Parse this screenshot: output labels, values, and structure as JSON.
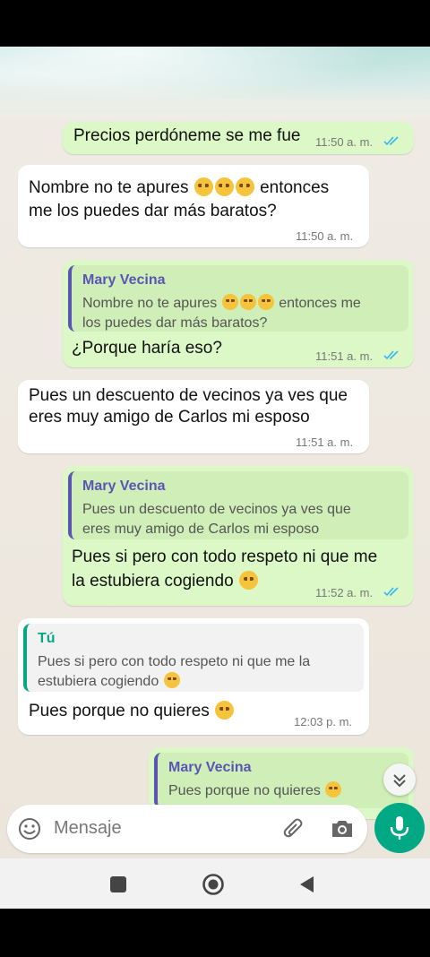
{
  "messages": [
    {
      "dir": "out",
      "text": "Precios perdóneme se me fue",
      "time": "11:50 a. m."
    },
    {
      "dir": "in",
      "line1_a": "Nombre no te apures",
      "line1_b": "entonces",
      "line2": "me los puedes dar más baratos?",
      "time": "11:50 a. m."
    },
    {
      "dir": "out",
      "quote_name": "Mary Vecina",
      "quote_l1_a": "Nombre no te apures",
      "quote_l1_b": "entonces me",
      "quote_l2": "los puedes dar más baratos?",
      "text": "¿Porque haría eso?",
      "time": "11:51 a. m."
    },
    {
      "dir": "in",
      "line1": "Pues un descuento de vecinos ya ves que",
      "line2": "eres muy amigo de Carlos mi esposo",
      "time": "11:51 a. m."
    },
    {
      "dir": "out",
      "quote_name": "Mary Vecina",
      "quote_l1": "Pues un descuento de vecinos ya ves que",
      "quote_l2": "eres muy amigo de Carlos mi esposo",
      "line1": "Pues si pero con todo respeto ni que me",
      "line2": "la estubiera cogiendo",
      "time": "11:52 a. m."
    },
    {
      "dir": "in",
      "quote_name": "Tú",
      "quote_l1": "Pues si pero con todo respeto ni que me la",
      "quote_l2": "estubiera cogiendo",
      "text": "Pues porque no quieres",
      "time": "12:03 p. m."
    },
    {
      "dir": "out",
      "quote_name": "Mary Vecina",
      "quote_l1": "Pues porque no quieres"
    }
  ],
  "input": {
    "placeholder": "Mensaje"
  },
  "icons": [
    "emoji-icon",
    "attach-icon",
    "camera-icon",
    "mic-icon",
    "scroll-down-icon",
    "nav-recents-icon",
    "nav-home-icon",
    "nav-back-icon"
  ],
  "colors": {
    "outgoing": "#dcf8c6",
    "incoming": "#ffffff",
    "accent": "#00a884",
    "quote_name": "#5b55b5",
    "tick": "#34b7f1"
  }
}
